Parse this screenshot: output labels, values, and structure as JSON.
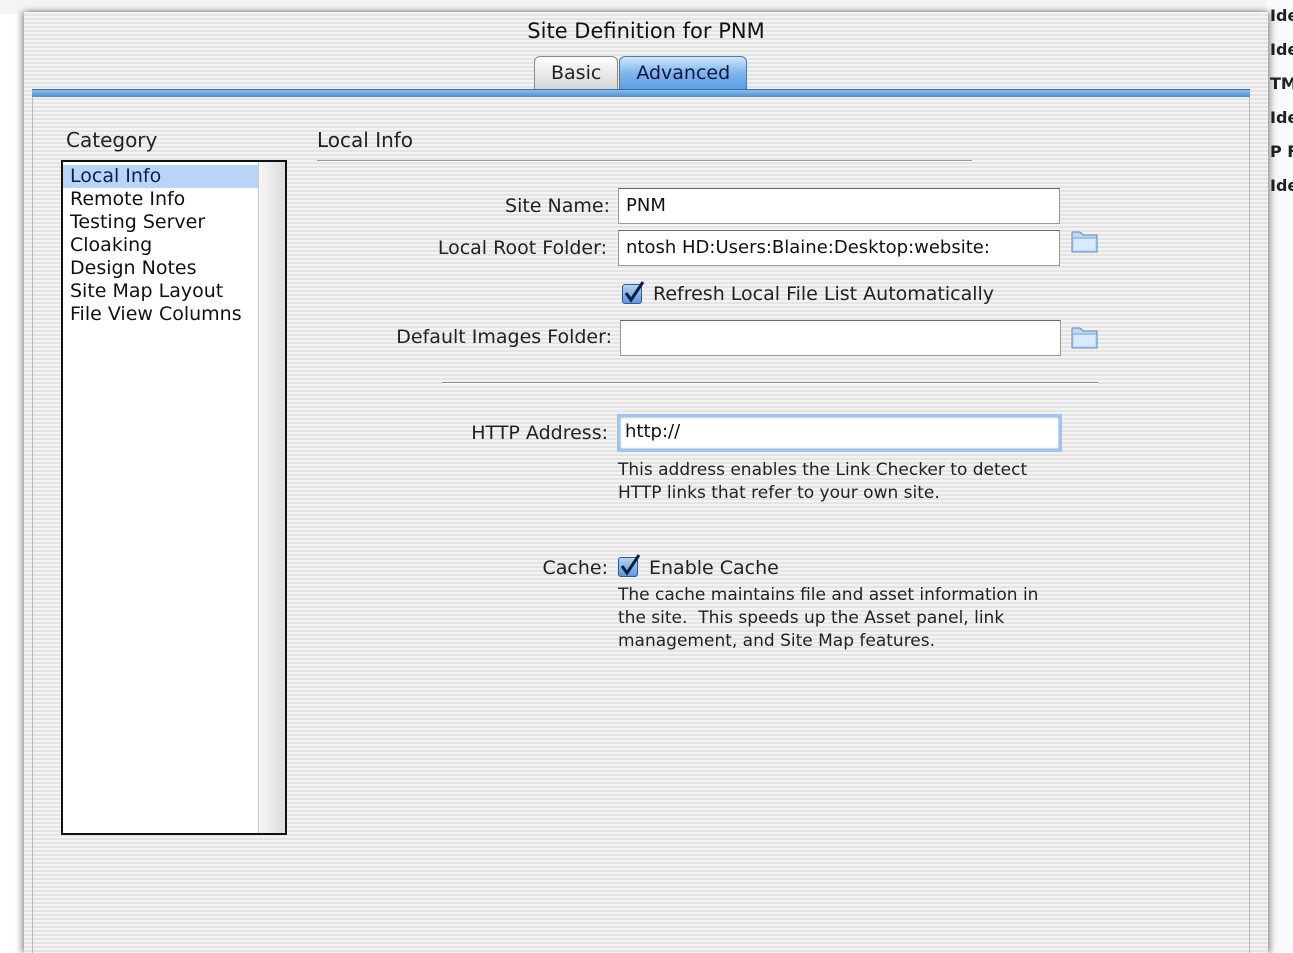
{
  "window": {
    "title": "Site Definition for PNM"
  },
  "tabs": [
    {
      "label": "Basic",
      "active": false
    },
    {
      "label": "Advanced",
      "active": true
    }
  ],
  "category": {
    "label": "Category",
    "items": [
      "Local Info",
      "Remote Info",
      "Testing Server",
      "Cloaking",
      "Design Notes",
      "Site Map Layout",
      "File View Columns"
    ],
    "selected": "Local Info"
  },
  "local_info": {
    "section_title": "Local Info",
    "site_name_label": "Site Name:",
    "site_name_value": "PNM",
    "local_root_label": "Local Root Folder:",
    "local_root_value": "ntosh HD:Users:Blaine:Desktop:website:",
    "refresh_label": "Refresh Local File List Automatically",
    "refresh_checked": true,
    "default_images_label": "Default Images Folder:",
    "default_images_value": "",
    "http_label": "HTTP Address:",
    "http_value": "http://",
    "http_help_1": "This address enables the Link Checker to detect",
    "http_help_2": "HTTP links that refer to your own site.",
    "cache_label": "Cache:",
    "cache_checkbox_label": "Enable Cache",
    "cache_checked": true,
    "cache_help_1": "The cache maintains file and asset information in",
    "cache_help_2": "the site.  This speeds up the Asset panel, link",
    "cache_help_3": "management, and Site Map features."
  },
  "background_window": {
    "lines": [
      "Ide",
      "Ide",
      "TMl",
      "Ide",
      "P F",
      "Ide"
    ]
  },
  "colors": {
    "accent": "#5d9fe4",
    "selection": "#b8d5f7"
  }
}
